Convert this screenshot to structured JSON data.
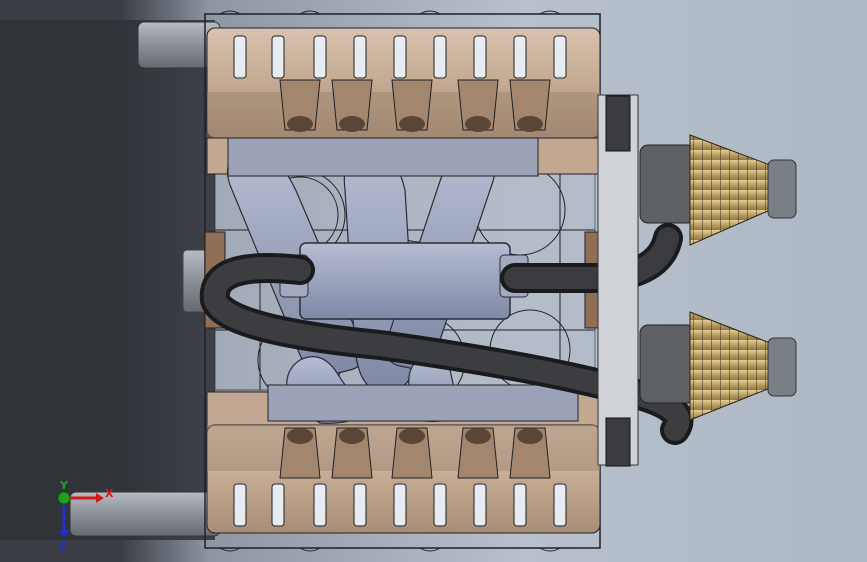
{
  "viewport": {
    "background_dark": "#34373d",
    "background_light": "#b4bdc9"
  },
  "model": {
    "body_color": "#c9b09a",
    "body_shadow": "#8a7565",
    "frame_line_color": "#1e2126",
    "manifold_color": "#9aa2bd",
    "hose_color": "#2b2c2f",
    "filter_color": "#c7b07a",
    "filter_cap_color": "#7a7f86"
  },
  "triad": {
    "x_label": "X",
    "y_label": "Y",
    "z_label": "Z",
    "x_color": "#d41818",
    "y_color": "#1fa11f",
    "z_color": "#2130c8",
    "icon": "axis-triad-icon"
  }
}
